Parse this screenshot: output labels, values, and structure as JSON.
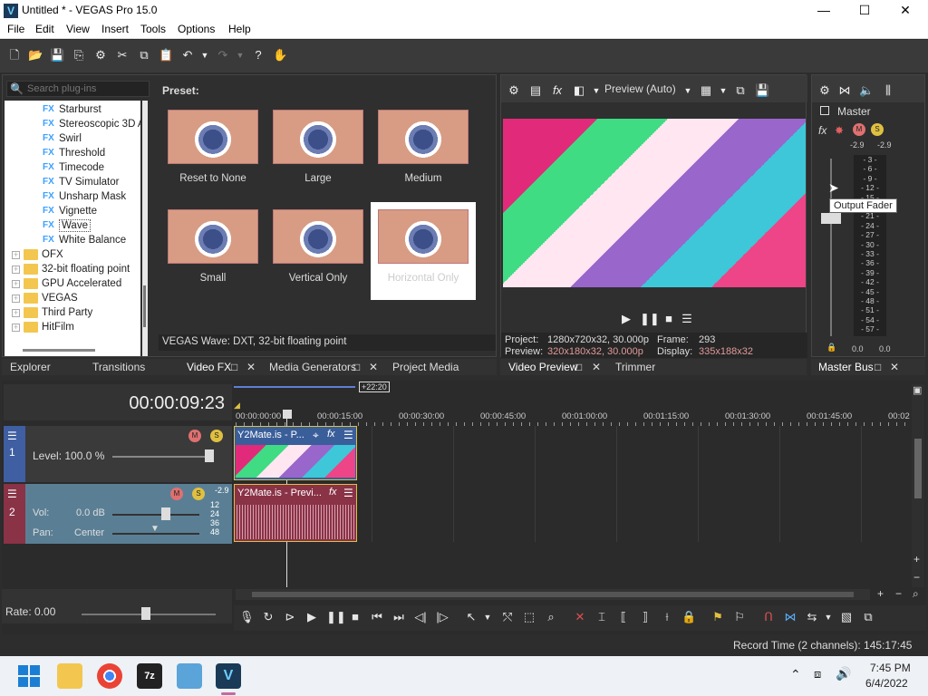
{
  "window": {
    "title": "Untitled * - VEGAS Pro 15.0",
    "logo": "V",
    "minimize": "—",
    "maximize": "☐",
    "close": "✕"
  },
  "menu": [
    "File",
    "Edit",
    "View",
    "Insert",
    "Tools",
    "Options",
    "Help"
  ],
  "explorer": {
    "search_placeholder": "Search plug-ins",
    "fx_items": [
      "Starburst",
      "Stereoscopic 3D A",
      "Swirl",
      "Threshold",
      "Timecode",
      "TV Simulator",
      "Unsharp Mask",
      "Vignette",
      "Wave",
      "White Balance"
    ],
    "selected_item": "Wave",
    "folders": [
      "OFX",
      "32-bit floating point",
      "GPU Accelerated",
      "VEGAS",
      "Third Party",
      "HitFilm"
    ],
    "preset_label": "Preset:",
    "presets": [
      "Reset to None",
      "Large",
      "Medium",
      "Small",
      "Vertical Only",
      "Horizontal Only"
    ],
    "selected_preset": "Horizontal Only",
    "status": "VEGAS Wave: DXT, 32-bit floating point",
    "tabs": [
      "Explorer",
      "Transitions",
      "Video FX",
      "Media Generators",
      "Project Media"
    ]
  },
  "preview": {
    "quality": "Preview (Auto)",
    "project_label": "Project:",
    "project_value": "1280x720x32, 30.000p",
    "preview_label": "Preview:",
    "preview_value": "320x180x32, 30.000p",
    "frame_label": "Frame:",
    "frame_value": "293",
    "display_label": "Display:",
    "display_value": "335x188x32",
    "tabs": [
      "Video Preview",
      "Trimmer"
    ]
  },
  "master": {
    "label": "Master",
    "peak_left": "-2.9",
    "peak_right": "-2.9",
    "scale": [
      "3",
      "6",
      "9",
      "12",
      "15",
      "18",
      "21",
      "24",
      "27",
      "30",
      "33",
      "36",
      "39",
      "42",
      "45",
      "48",
      "51",
      "54",
      "57"
    ],
    "bottom_left": "0.0",
    "bottom_right": "0.0",
    "tooltip": "Output Fader",
    "tab": "Master Bus"
  },
  "timeline": {
    "timecode": "00:00:09:23",
    "loop_label": "+22:20",
    "ruler": [
      "00:00:00:00",
      "00:00:15:00",
      "00:00:30:00",
      "00:00:45:00",
      "00:01:00:00",
      "00:01:15:00",
      "00:01:30:00",
      "00:01:45:00",
      "00:02"
    ],
    "track1": {
      "number": "1",
      "level_label": "Level: 100.0 %",
      "clip": "Y2Mate.is - P..."
    },
    "track2": {
      "number": "2",
      "vol_label": "Vol:",
      "vol_value": "0.0 dB",
      "pan_label": "Pan:",
      "pan_value": "Center",
      "peak": "-2.9",
      "meter": [
        "12",
        "24",
        "36",
        "48"
      ],
      "clip": "Y2Mate.is - Previ..."
    },
    "rate": "Rate: 0.00",
    "record_time": "Record Time (2 channels): 145:17:45"
  },
  "taskbar": {
    "time": "7:45 PM",
    "date": "6/4/2022"
  }
}
